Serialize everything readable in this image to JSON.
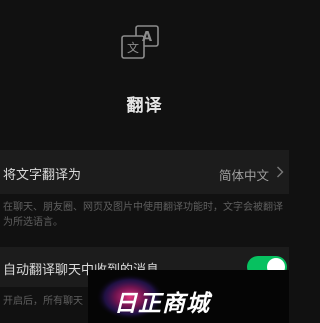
{
  "header": {
    "icon": "translate-icon",
    "icon_glyph_a": "A",
    "icon_glyph_wen": "文",
    "title": "翻译"
  },
  "language_setting": {
    "label": "将文字翻译为",
    "value": "简体中文",
    "chevron": "chevron-right-icon",
    "description": "在聊天、朋友圈、网页及图片中使用翻译功能时，文字会被翻译为所选语言。"
  },
  "auto_translate": {
    "label": "自动翻译聊天中收到的消息",
    "enabled": true,
    "description": "开启后，所有聊天"
  },
  "watermark": {
    "text": "日正商城"
  },
  "colors": {
    "background": "#111111",
    "row_background": "#1c1c1c",
    "toggle_on": "#07c160"
  }
}
